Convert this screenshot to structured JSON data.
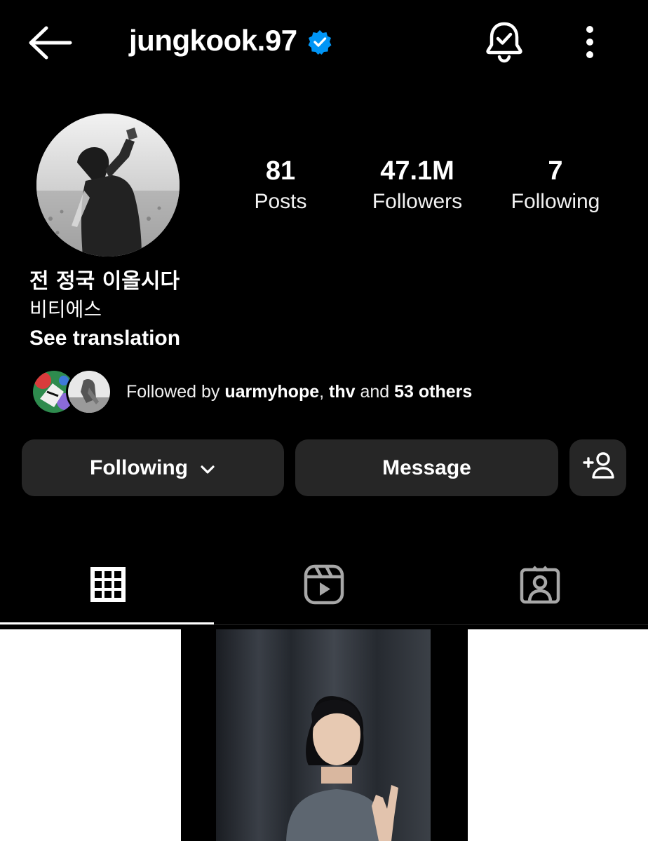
{
  "header": {
    "username": "jungkook.97",
    "verified": true,
    "icons": [
      "back-arrow-icon",
      "verified-badge-icon",
      "notification-bell-icon",
      "more-options-icon"
    ]
  },
  "profile": {
    "stats": {
      "posts_count": "81",
      "posts_label": "Posts",
      "followers_count": "47.1M",
      "followers_label": "Followers",
      "following_count": "7",
      "following_label": "Following"
    },
    "bio": {
      "name": "전 정국 이올시다",
      "line": "비티에스",
      "translate": "See translation"
    },
    "followed_by": {
      "prefix": "Followed by",
      "user1": "uarmyhope",
      "separator": ",",
      "user2": "thv",
      "conjunction": "and",
      "others": "53 others"
    }
  },
  "actions": {
    "following_label": "Following",
    "message_label": "Message",
    "suggest_icon": "add-person-icon"
  },
  "tabs": {
    "items": [
      "grid-icon",
      "reels-icon",
      "tagged-icon"
    ],
    "active": "grid"
  },
  "colors": {
    "background": "#000000",
    "button_bg": "#262626",
    "verified_blue": "#0095F6",
    "text": "#FFFFFF"
  }
}
